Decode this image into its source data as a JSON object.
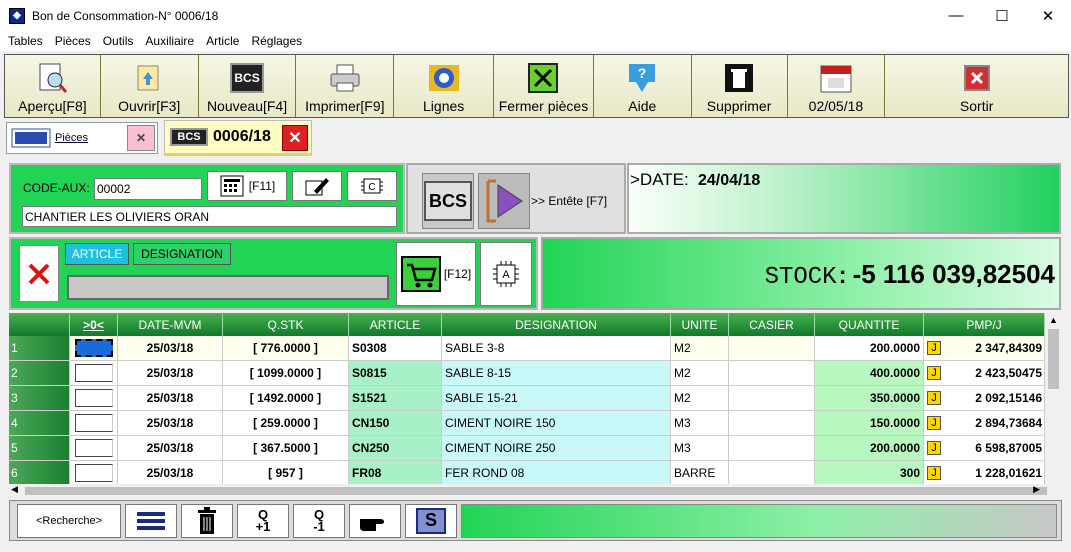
{
  "window": {
    "title": "Bon de Consommation-N° 0006/18"
  },
  "menu": [
    "Tables",
    "Pièces",
    "Outils",
    "Auxiliaire",
    "Article",
    "Réglages"
  ],
  "toolbar": [
    {
      "label": "Aperçu[F8]",
      "icon": "preview-icon"
    },
    {
      "label": "Ouvrir[F3]",
      "icon": "open-icon"
    },
    {
      "label": "Nouveau[F4]",
      "icon": "bcs-new-icon"
    },
    {
      "label": "Imprimer[F9]",
      "icon": "printer-icon"
    },
    {
      "label": "Lignes",
      "icon": "lines-icon"
    },
    {
      "label": "Fermer pièces",
      "icon": "close-pieces-icon"
    },
    {
      "label": "Aide",
      "icon": "help-icon"
    },
    {
      "label": "Supprimer",
      "icon": "trash-icon"
    },
    {
      "label": "02/05/18",
      "icon": "calendar-icon"
    },
    {
      "label": "Sortir",
      "icon": "exit-icon"
    }
  ],
  "tabs": {
    "pieces_label": "Pièces",
    "bcs_logo": "BCS",
    "current_doc": "0006/18"
  },
  "header": {
    "code_aux_label": "CODE-AUX:",
    "code_aux_value": "00002",
    "f11_label": "[F11]",
    "client_name": "CHANTIER LES OLIVIERS ORAN",
    "bcs_big": "BCS",
    "entete_label": ">> Entête [F7]",
    "date_prefix": ">DATE:",
    "date_value": "24/04/18"
  },
  "article_panel": {
    "tab_article": "ARTICLE",
    "tab_designation": "DESIGNATION",
    "f12_label": "[F12]"
  },
  "stock": {
    "label": "STOCK",
    "value": "-5 116 039,82504"
  },
  "table": {
    "columns": [
      "",
      "",
      ">0<",
      "DATE-MVM",
      "Q.STK",
      "ARTICLE",
      "DESIGNATION",
      "UNITE",
      "CASIER",
      "QUANTITE",
      "PMP/J"
    ],
    "rows": [
      {
        "n": "1",
        "date": "25/03/18",
        "qstk": "[ 776.0000 ]",
        "article": "S0308",
        "designation": "SABLE 3-8",
        "unite": "M2",
        "casier": "",
        "quantite": "200.0000",
        "j": "J",
        "pmp": "2 347,84309"
      },
      {
        "n": "2",
        "date": "25/03/18",
        "qstk": "[ 1099.0000 ]",
        "article": "S0815",
        "designation": "SABLE 8-15",
        "unite": "M2",
        "casier": "",
        "quantite": "400.0000",
        "j": "J",
        "pmp": "2 423,50475"
      },
      {
        "n": "3",
        "date": "25/03/18",
        "qstk": "[ 1492.0000 ]",
        "article": "S1521",
        "designation": "SABLE 15-21",
        "unite": "M2",
        "casier": "",
        "quantite": "350.0000",
        "j": "J",
        "pmp": "2 092,15146"
      },
      {
        "n": "4",
        "date": "25/03/18",
        "qstk": "[ 259.0000 ]",
        "article": "CN150",
        "designation": "CIMENT NOIRE 150",
        "unite": "M3",
        "casier": "",
        "quantite": "150.0000",
        "j": "J",
        "pmp": "2 894,73684"
      },
      {
        "n": "5",
        "date": "25/03/18",
        "qstk": "[ 367.5000 ]",
        "article": "CN250",
        "designation": "CIMENT NOIRE 250",
        "unite": "M3",
        "casier": "",
        "quantite": "200.0000",
        "j": "J",
        "pmp": "6 598,87005"
      },
      {
        "n": "6",
        "date": "25/03/18",
        "qstk": "[ 957 ]",
        "article": "FR08",
        "designation": "FER ROND 08",
        "unite": "BARRE",
        "casier": "",
        "quantite": "300",
        "j": "J",
        "pmp": "1 228,01621"
      }
    ]
  },
  "bottom": {
    "search_label": "<Recherche>",
    "qplus": "Q\n+1",
    "qminus": "Q\n-1",
    "s_label": "S"
  }
}
